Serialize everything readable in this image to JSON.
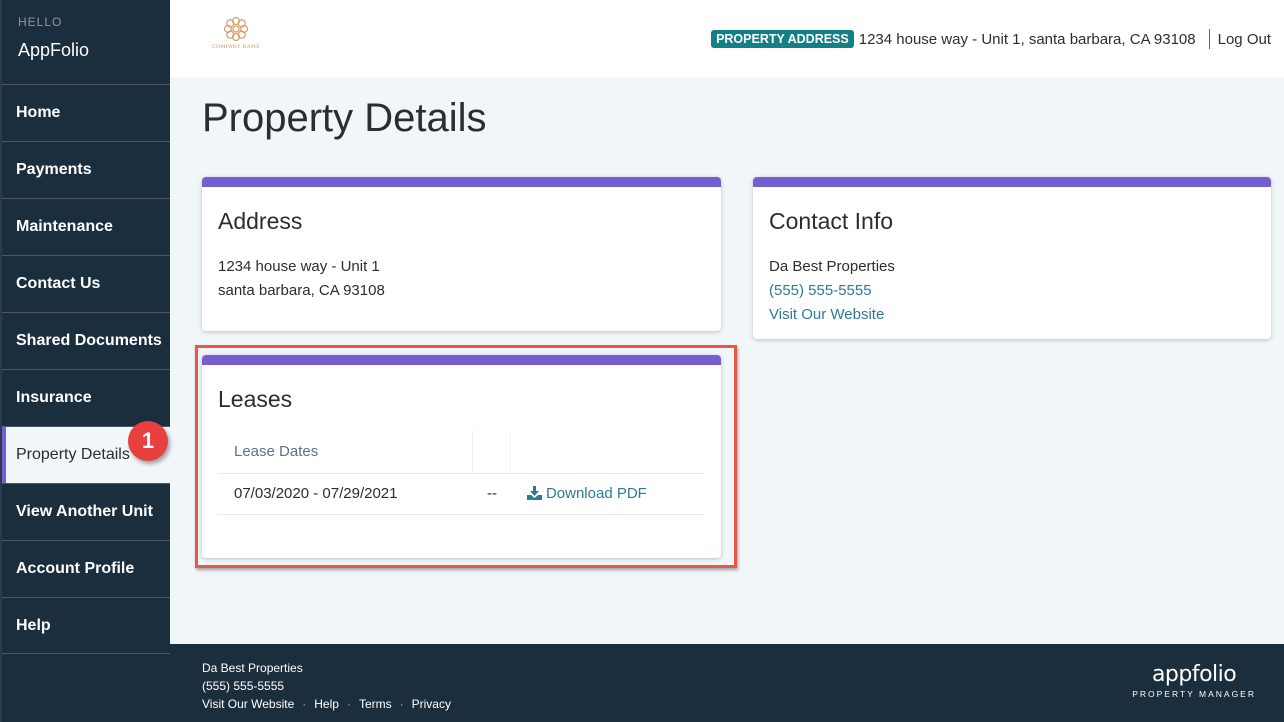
{
  "sidebar": {
    "greeting": "HELLO",
    "app_name": "AppFolio",
    "items": [
      {
        "label": "Home"
      },
      {
        "label": "Payments"
      },
      {
        "label": "Maintenance"
      },
      {
        "label": "Contact Us"
      },
      {
        "label": "Shared Documents"
      },
      {
        "label": "Insurance"
      },
      {
        "label": "Property Details",
        "active": true
      },
      {
        "label": "View Another Unit"
      },
      {
        "label": "Account Profile"
      },
      {
        "label": "Help"
      }
    ],
    "step_badge": "1"
  },
  "header": {
    "logo_text": "COMPANY NAME",
    "address_badge": "PROPERTY ADDRESS",
    "address": "1234 house way - Unit 1, santa barbara, CA 93108",
    "logout_label": "Log Out"
  },
  "main": {
    "page_title": "Property Details",
    "address_card": {
      "title": "Address",
      "line1": "1234 house way - Unit 1",
      "line2": "santa barbara, CA 93108"
    },
    "contact_card": {
      "title": "Contact Info",
      "company": "Da Best Properties",
      "phone": "(555) 555-5555",
      "website_label": "Visit Our Website"
    },
    "leases_card": {
      "title": "Leases",
      "columns": [
        "Lease Dates",
        "",
        ""
      ],
      "rows": [
        {
          "dates": "07/03/2020 - 07/29/2021",
          "status": "--",
          "action_label": "Download PDF"
        }
      ]
    }
  },
  "footer": {
    "company": "Da Best Properties",
    "phone": "(555) 555-5555",
    "links": [
      "Visit Our Website",
      "Help",
      "Terms",
      "Privacy"
    ],
    "separator": "·",
    "brand": "appfolio",
    "brand_sub": "PROPERTY MANAGER"
  },
  "colors": {
    "sidebar_bg": "#1b2e3e",
    "accent_purple": "#755fcf",
    "badge_teal": "#137f86",
    "link": "#2d7a9a",
    "highlight_red": "#e8574a",
    "step_badge_red": "#e8403f"
  }
}
